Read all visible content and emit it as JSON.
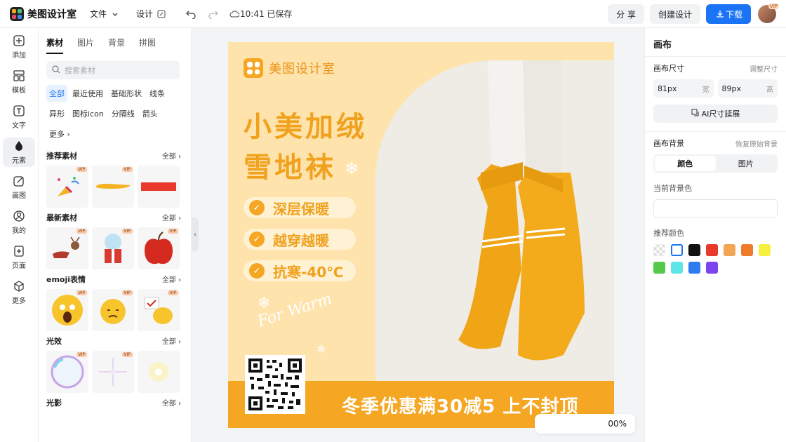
{
  "header": {
    "app_name": "美图设计室",
    "menu_file": "文件",
    "menu_design": "设计",
    "save_status": "10:41 已保存",
    "share_label": "分 享",
    "create_label": "创建设计",
    "download_label": "下载",
    "avatar_badge": "VIP"
  },
  "rail": {
    "items": [
      {
        "label": "添加",
        "icon": "plus-square-icon"
      },
      {
        "label": "模板",
        "icon": "template-icon"
      },
      {
        "label": "文字",
        "icon": "text-icon"
      },
      {
        "label": "元素",
        "icon": "shapes-icon"
      },
      {
        "label": "画图",
        "icon": "draw-icon"
      },
      {
        "label": "我的",
        "icon": "user-icon"
      },
      {
        "label": "页面",
        "icon": "page-add-icon"
      },
      {
        "label": "更多",
        "icon": "cube-icon"
      }
    ]
  },
  "panel": {
    "tabs": [
      "素材",
      "图片",
      "背景",
      "拼图"
    ],
    "search_placeholder": "搜索素材",
    "chips": [
      "全部",
      "最近使用",
      "基础形状",
      "线条",
      "异形",
      "图标icon",
      "分隔线",
      "箭头",
      "更多"
    ],
    "see_all": "全部",
    "vip": "VIP",
    "sections": [
      {
        "title": "推荐素材"
      },
      {
        "title": "最新素材"
      },
      {
        "title": "emoji表情"
      },
      {
        "title": "光效"
      },
      {
        "title": "光影"
      }
    ]
  },
  "canvas": {
    "brand": "美图设计室",
    "title_line1": "小美加绒",
    "title_line2": "雪地袜",
    "features": [
      "深层保暖",
      "越穿越暖",
      "抗寒-40℃"
    ],
    "script_text": "For Warm",
    "banner": "冬季优惠满30减5 上不封顶"
  },
  "zoom": {
    "value": "00%"
  },
  "right": {
    "title": "画布",
    "size_label": "画布尺寸",
    "size_hint": "调整尺寸",
    "width_value": "81px",
    "width_unit": "宽",
    "height_value": "89px",
    "height_unit": "高",
    "ai_button": "AI尺寸延展",
    "bg_label": "画布背景",
    "bg_hint": "恢复原始背景",
    "seg_color": "颜色",
    "seg_image": "图片",
    "current_bg": "当前背景色",
    "recommend": "推荐颜色",
    "colors": [
      "transparent",
      "#ffffff",
      "#111111",
      "#e8392b",
      "#f2a553",
      "#ef7a2b",
      "#f6ef3f",
      "#55c94a",
      "#5de6e6",
      "#2f7bf0",
      "#7a44ef"
    ]
  },
  "colors": {
    "accent": "#1b74f5",
    "canvas_bg": "#ffe3ad",
    "brand_orange": "#f5a623"
  }
}
